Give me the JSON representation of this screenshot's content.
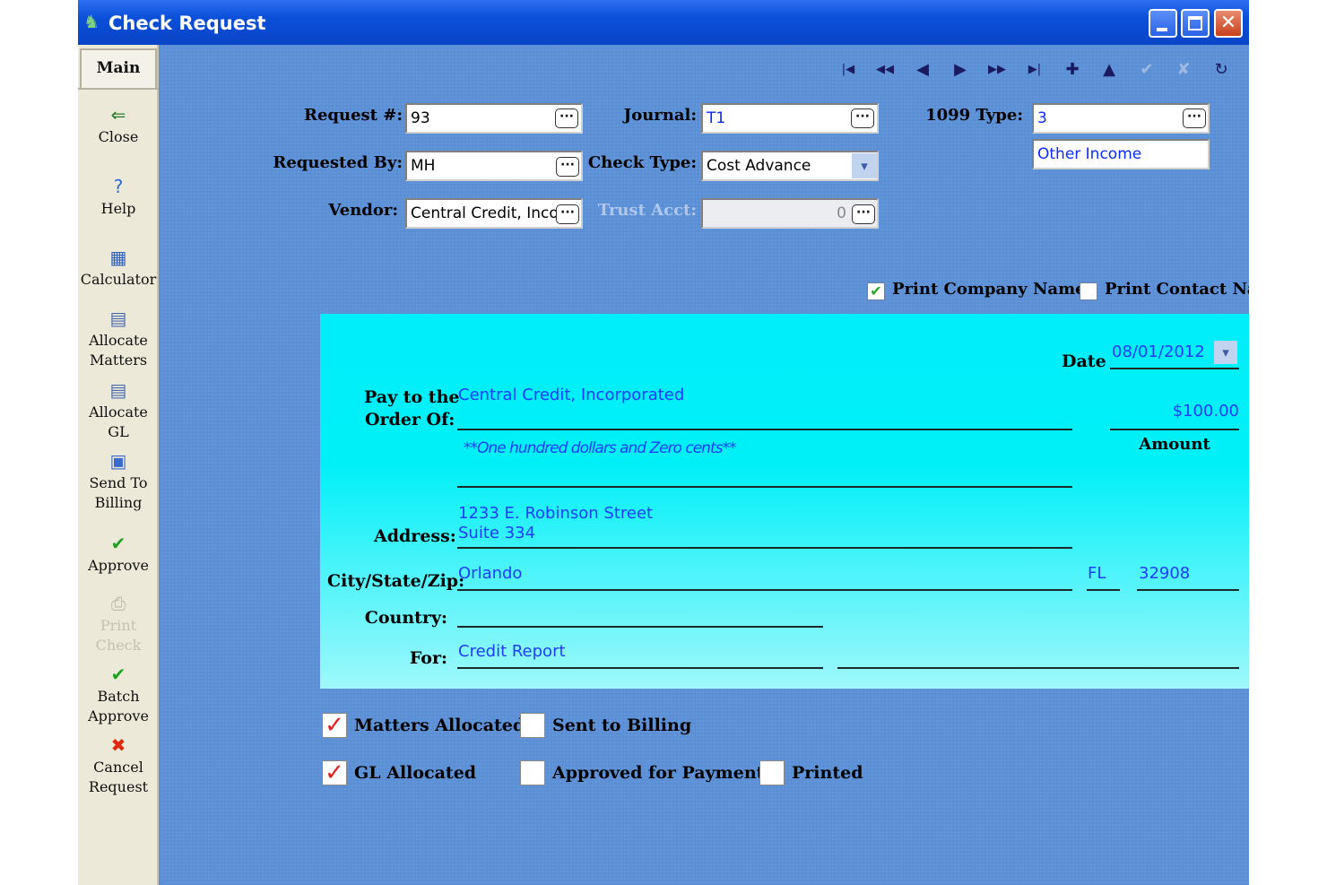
{
  "window": {
    "title": "Check Request",
    "minimize_icon": "minimize-icon",
    "maximize_icon": "maximize-icon",
    "close_icon": "close-icon"
  },
  "sidebar": {
    "tab_label": "Main",
    "items": [
      {
        "label_lines": [
          "Close"
        ],
        "icon": "door-exit-icon",
        "glyph": "⇐",
        "color": "#2a7a2a",
        "enabled": true
      },
      {
        "label_lines": [
          "Help"
        ],
        "icon": "help-icon",
        "glyph": "?",
        "color": "#2a6ad8",
        "enabled": true
      },
      {
        "label_lines": [
          "Calculator"
        ],
        "icon": "calculator-icon",
        "glyph": "▦",
        "color": "#3060c0",
        "enabled": true
      },
      {
        "label_lines": [
          "Allocate",
          "Matters"
        ],
        "icon": "document-icon",
        "glyph": "▤",
        "color": "#4a6ab0",
        "enabled": true
      },
      {
        "label_lines": [
          "Allocate",
          "GL"
        ],
        "icon": "document-icon",
        "glyph": "▤",
        "color": "#4a6ab0",
        "enabled": true
      },
      {
        "label_lines": [
          "Send To",
          "Billing"
        ],
        "icon": "send-to-billing-icon",
        "glyph": "▣",
        "color": "#3a6ad0",
        "enabled": true
      },
      {
        "label_lines": [
          "Approve"
        ],
        "icon": "checkmark-icon",
        "glyph": "✔",
        "color": "#22a022",
        "enabled": true
      },
      {
        "label_lines": [
          "Print",
          "Check"
        ],
        "icon": "printer-icon",
        "glyph": "⎙",
        "color": "#b8b6a8",
        "enabled": false
      },
      {
        "label_lines": [
          "Batch",
          "Approve"
        ],
        "icon": "batch-approve-icon",
        "glyph": "✔",
        "color": "#22a022",
        "enabled": true
      },
      {
        "label_lines": [
          "Cancel",
          "Request"
        ],
        "icon": "cancel-x-icon",
        "glyph": "✖",
        "color": "#e02a10",
        "enabled": true
      }
    ]
  },
  "toolbar": {
    "buttons": [
      {
        "name": "first-record-icon",
        "glyph": "|◀",
        "enabled": true
      },
      {
        "name": "previous-page-icon",
        "glyph": "◀◀",
        "enabled": true
      },
      {
        "name": "previous-record-icon",
        "glyph": "◀",
        "enabled": true
      },
      {
        "name": "next-record-icon",
        "glyph": "▶",
        "enabled": true
      },
      {
        "name": "next-page-icon",
        "glyph": "▶▶",
        "enabled": true
      },
      {
        "name": "last-record-icon",
        "glyph": "▶|",
        "enabled": true
      },
      {
        "name": "add-record-icon",
        "glyph": "✚",
        "enabled": true
      },
      {
        "name": "edit-up-icon",
        "glyph": "▲",
        "enabled": true
      },
      {
        "name": "save-check-icon",
        "glyph": "✔",
        "enabled": false
      },
      {
        "name": "cancel-edit-icon",
        "glyph": "✘",
        "enabled": false
      },
      {
        "name": "refresh-icon",
        "glyph": "↻",
        "enabled": true
      },
      {
        "name": "tag-icon",
        "glyph": "✎",
        "enabled": true
      },
      {
        "name": "wand-icon",
        "glyph": "✐",
        "enabled": false
      }
    ]
  },
  "form": {
    "request_label": "Request #:",
    "request_value": "93",
    "journal_label": "Journal:",
    "journal_value": "T1",
    "type1099_label": "1099 Type:",
    "type1099_value": "3",
    "type1099_desc": "Other Income",
    "requested_by_label": "Requested By:",
    "requested_by_value": "MH",
    "check_type_label": "Check Type:",
    "check_type_value": "Cost Advance",
    "vendor_label": "Vendor:",
    "vendor_value": "Central Credit, Incorp",
    "trust_acct_label": "Trust Acct:",
    "trust_acct_value": "0",
    "ellipsis": "···"
  },
  "print_options": {
    "company_name_label": "Print Company Name",
    "company_name_checked": true,
    "contact_name_label": "Print Contact Name",
    "contact_name_checked": false
  },
  "check": {
    "date_label": "Date",
    "date_value": "08/01/2012",
    "pay_to_label_1": "Pay to the",
    "pay_to_label_2": "Order Of:",
    "payee": "Central Credit, Incorporated",
    "amount_value": "$100.00",
    "amount_label": "Amount",
    "amount_words": "**One hundred dollars and Zero cents**",
    "address_label": "Address:",
    "address_line1": "1233 E. Robinson Street",
    "address_line2": "Suite 334",
    "city_state_zip_label": "City/State/Zip:",
    "city": "Orlando",
    "state": "FL",
    "zip": "32908",
    "country_label": "Country:",
    "country_value": "",
    "for_label": "For:",
    "for_value": "Credit Report"
  },
  "flags": {
    "matters_allocated_label": "Matters Allocated",
    "matters_allocated": true,
    "gl_allocated_label": "GL Allocated",
    "gl_allocated": true,
    "sent_to_billing_label": "Sent to Billing",
    "sent_to_billing": false,
    "approved_label": "Approved for Payment",
    "approved": false,
    "printed_label": "Printed",
    "printed": false
  },
  "colors": {
    "title_bar": "#0a4fd8",
    "form_background": "#5b8fd6",
    "check_background": "#00eefa",
    "value_text": "#1f3cff",
    "checkmark_red": "#e02020"
  }
}
